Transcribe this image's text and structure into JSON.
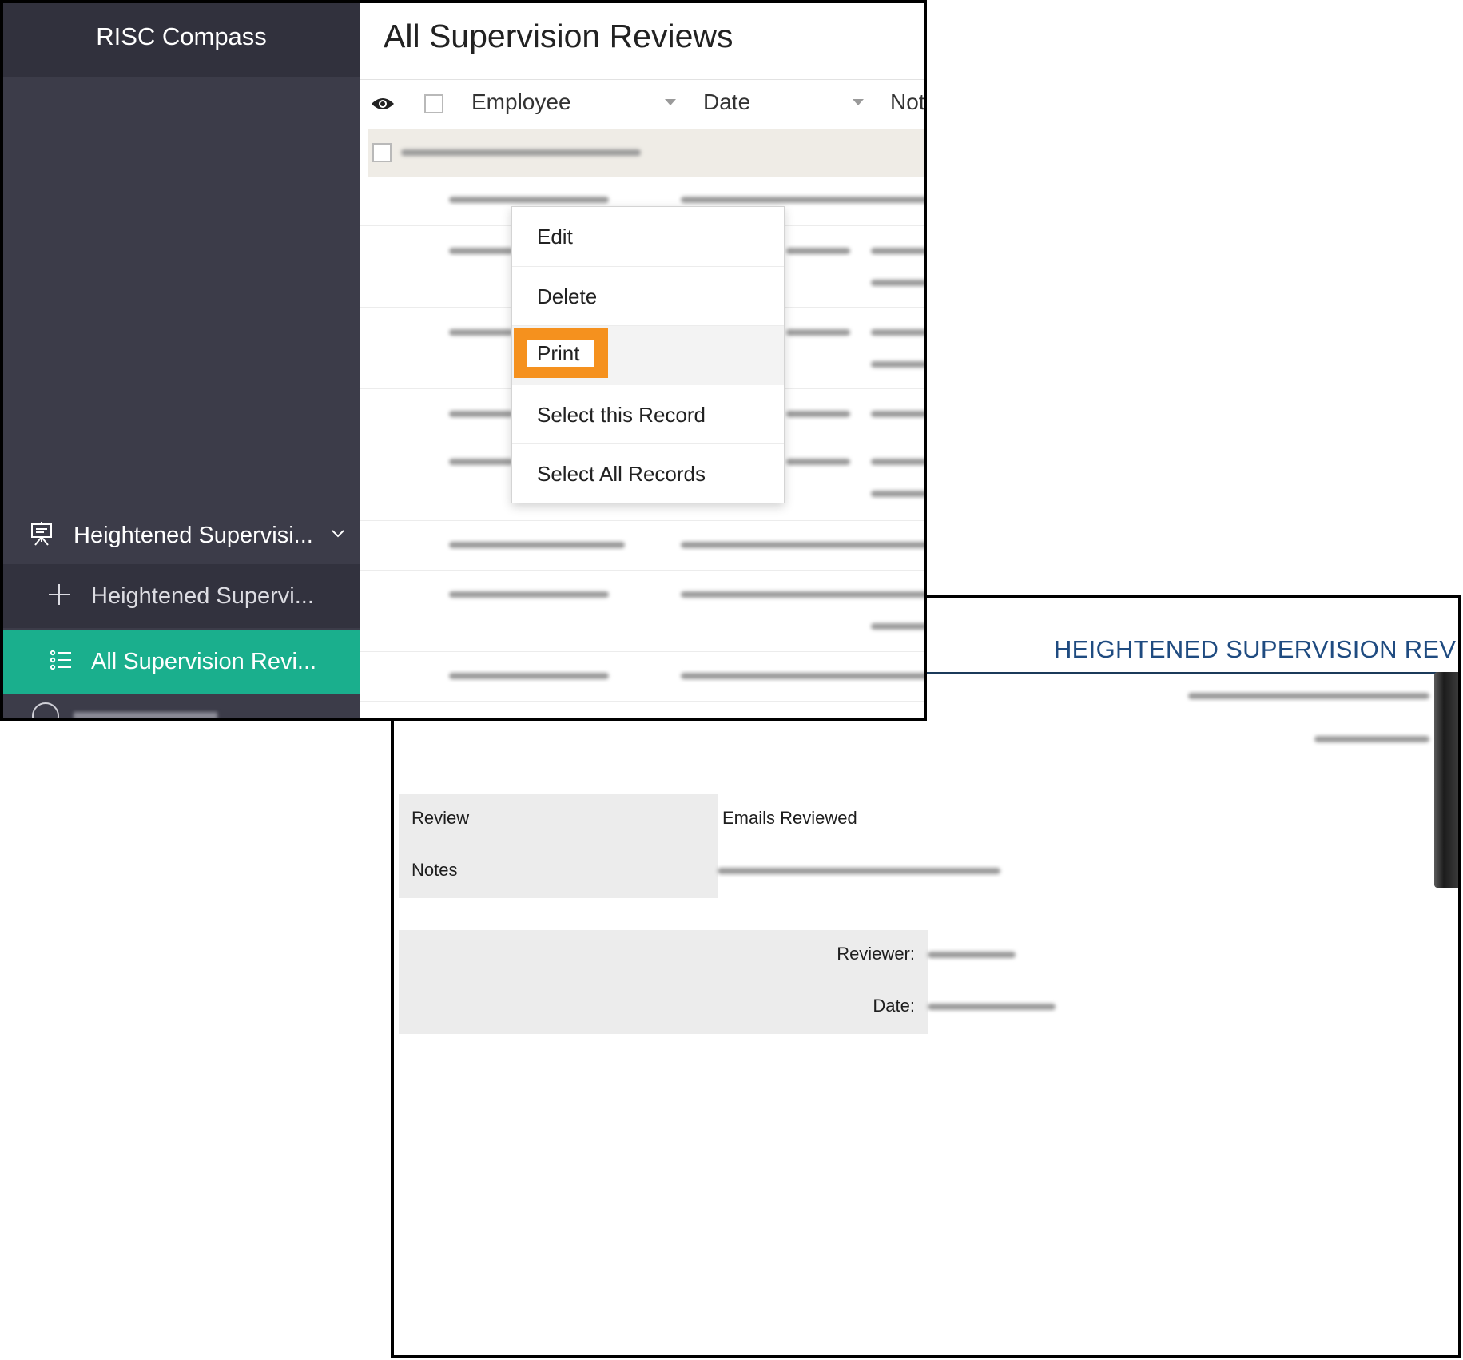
{
  "app": {
    "name": "RISC Compass"
  },
  "sidebar": {
    "group": {
      "label": "Heightened Supervisi...",
      "icon": "presentation-board-icon"
    },
    "items": [
      {
        "label": "Heightened Supervi...",
        "icon": "plus-icon"
      },
      {
        "label": "All Supervision Revi...",
        "icon": "list-icon",
        "active": true
      }
    ]
  },
  "main": {
    "title": "All Supervision Reviews",
    "columns": [
      "Employee",
      "Date",
      "Not"
    ]
  },
  "context_menu": {
    "items": [
      "Edit",
      "Delete",
      "Print",
      "Select this Record",
      "Select All Records"
    ],
    "highlighted": "Print",
    "highlight_color": "#f5911e"
  },
  "print_preview": {
    "title": "HEIGHTENED SUPERVISION REVIEW",
    "fields": [
      {
        "label": "Review",
        "value": "Emails Reviewed"
      },
      {
        "label": "Notes",
        "value": ""
      }
    ],
    "signoff": {
      "reviewer_label": "Reviewer:",
      "date_label": "Date:"
    }
  },
  "colors": {
    "sidebar_bg": "#3c3c49",
    "active_item": "#1aaf8d",
    "print_title": "#1f4b80"
  }
}
